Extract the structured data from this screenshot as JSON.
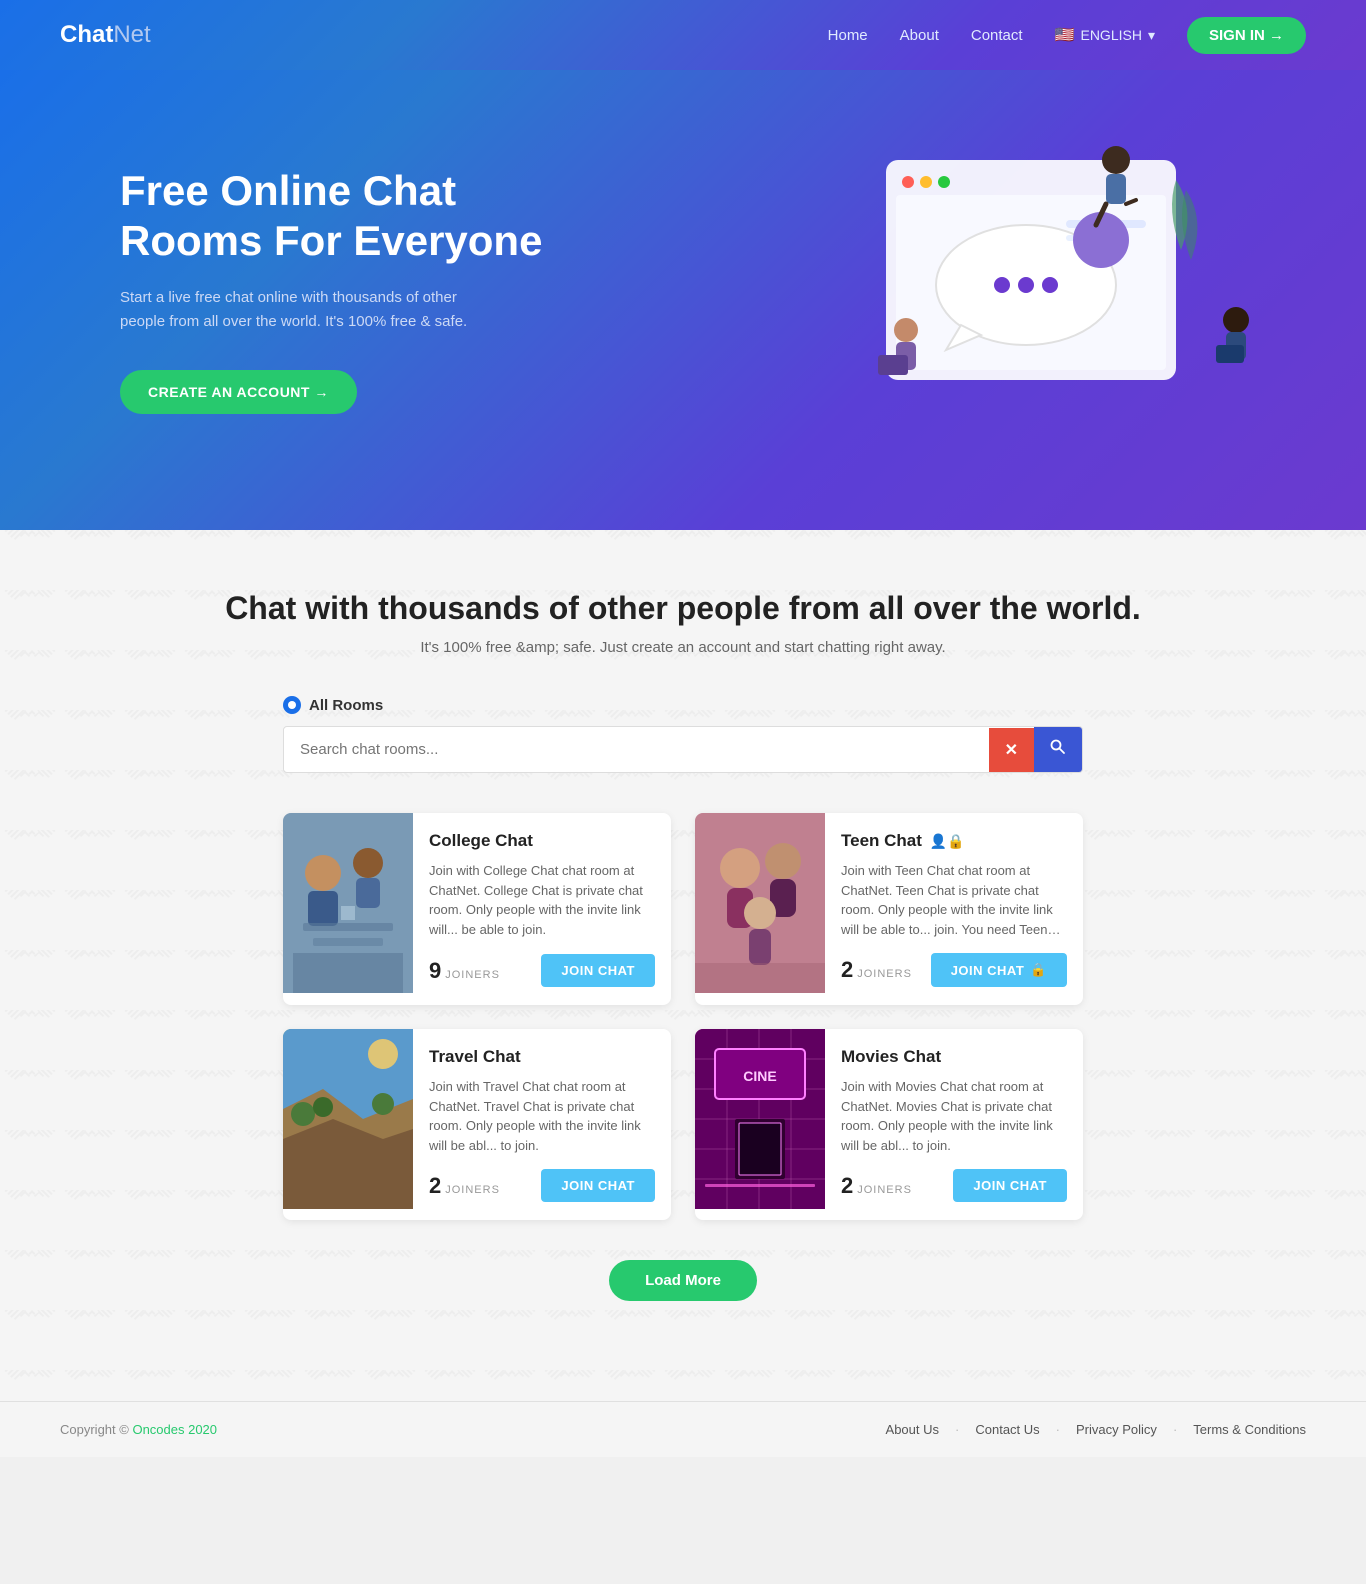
{
  "site": {
    "name_chat": "Chat",
    "name_net": "Net"
  },
  "nav": {
    "home": "Home",
    "about": "About",
    "contact": "Contact",
    "language": "ENGLISH",
    "sign_in": "SIGN IN →"
  },
  "hero": {
    "title": "Free Online Chat Rooms For Everyone",
    "subtitle": "Start a live free chat online with thousands of other people from all over the world. It's 100% free & safe.",
    "cta": "CREATE AN ACCOUNT →"
  },
  "section": {
    "title": "Chat with thousands of other people from all over the world.",
    "subtitle": "It's 100% free &amp; safe. Just create an account and start chatting right away."
  },
  "search": {
    "all_rooms_label": "All Rooms",
    "placeholder": "Search chat rooms...",
    "clear_label": "✕",
    "go_label": "🔍"
  },
  "cards": [
    {
      "id": "college",
      "title": "College Chat",
      "description": "Join with College Chat chat room at ChatNet. College Chat is private chat room. Only people with the invite link will... be able to join.",
      "joiners": "9",
      "joiners_label": "JOINERS",
      "join_btn": "JOIN CHAT",
      "private": false,
      "img_class": "img-college"
    },
    {
      "id": "teen",
      "title": "Teen Chat",
      "description": "Join with Teen Chat chat room at ChatNet. Teen Chat is private chat room. Only people with the invite link will be able to... join. You need Teen Chat password to log",
      "joiners": "2",
      "joiners_label": "JOINERS",
      "join_btn": "JOIN CHAT 🔒",
      "private": true,
      "img_class": "img-teen"
    },
    {
      "id": "travel",
      "title": "Travel Chat",
      "description": "Join with Travel Chat chat room at ChatNet. Travel Chat is private chat room. Only people with the invite link will be abl... to join.",
      "joiners": "2",
      "joiners_label": "JOINERS",
      "join_btn": "JOIN CHAT",
      "private": false,
      "img_class": "img-travel"
    },
    {
      "id": "movies",
      "title": "Movies Chat",
      "description": "Join with Movies Chat chat room at ChatNet. Movies Chat is private chat room. Only people with the invite link will be abl... to join.",
      "joiners": "2",
      "joiners_label": "JOINERS",
      "join_btn": "JOIN CHAT",
      "private": false,
      "img_class": "img-movies"
    }
  ],
  "load_more": "Load More",
  "footer": {
    "copy": "Copyright © Oncodes 2020",
    "links": [
      "About Us",
      "Contact Us",
      "Privacy Policy",
      "Terms & Conditions"
    ]
  }
}
